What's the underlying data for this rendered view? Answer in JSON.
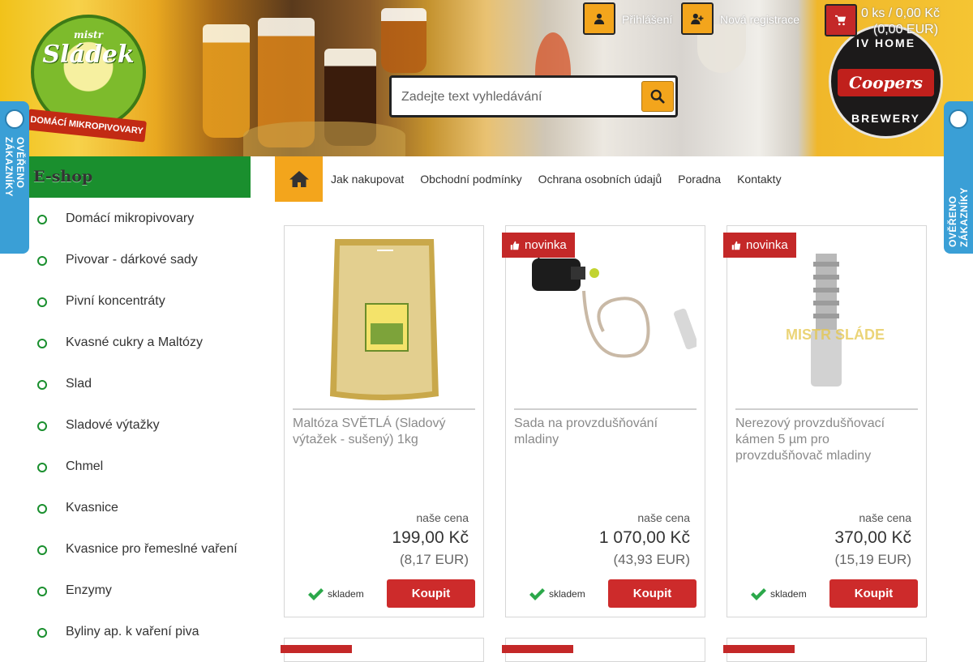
{
  "header": {
    "logo_left": {
      "brand_top": "mistr",
      "brand_main": "Sládek",
      "ribbon": "DOMÁCÍ MIKROPIVOVARY"
    },
    "logo_right": {
      "top": "IV HOME",
      "middle": "Coopers",
      "bottom": "BREWERY"
    },
    "login_label": "Přihlášení",
    "register_label": "Nová registrace",
    "cart": {
      "summary": "0 ks / 0,00 Kč",
      "summary_eur": "(0,00 EUR)"
    },
    "search": {
      "placeholder": "Zadejte text vyhledávání"
    }
  },
  "verified_badge": {
    "text": "OVĚŘENO ZÁKAZNÍKY"
  },
  "sidebar": {
    "title": "E-shop",
    "items": [
      {
        "label": "Domácí mikropivovary"
      },
      {
        "label": "Pivovar - dárkové sady"
      },
      {
        "label": "Pivní koncentráty"
      },
      {
        "label": "Kvasné cukry a Maltózy"
      },
      {
        "label": "Slad"
      },
      {
        "label": "Sladové výtažky"
      },
      {
        "label": "Chmel"
      },
      {
        "label": "Kvasnice"
      },
      {
        "label": "Kvasnice pro řemeslné vaření"
      },
      {
        "label": "Enzymy"
      },
      {
        "label": "Byliny ap. k vaření piva"
      }
    ]
  },
  "nav": {
    "links": [
      {
        "label": "Jak nakupovat"
      },
      {
        "label": "Obchodní podmínky"
      },
      {
        "label": "Ochrana osobních údajů"
      },
      {
        "label": "Poradna"
      },
      {
        "label": "Kontakty"
      }
    ]
  },
  "products": [
    {
      "name": "Maltóza SVĚTLÁ (Sladový výtažek - sušený) 1kg",
      "badge": "",
      "price_label": "naše cena",
      "price": "199,00 Kč",
      "price_eur": "(8,17 EUR)",
      "stock": "skladem",
      "buy_label": "Koupit",
      "image_text": ""
    },
    {
      "name": "Sada na provzdušňování mladiny",
      "badge": "novinka",
      "price_label": "naše cena",
      "price": "1 070,00 Kč",
      "price_eur": "(43,93 EUR)",
      "stock": "skladem",
      "buy_label": "Koupit",
      "image_text": ""
    },
    {
      "name": "Nerezový provzdušňovací kámen 5 µm pro provzdušňovač mladiny",
      "badge": "novinka",
      "price_label": "naše cena",
      "price": "370,00 Kč",
      "price_eur": "(15,19 EUR)",
      "stock": "skladem",
      "buy_label": "Koupit",
      "image_text": "MISTR SLÁDE"
    }
  ],
  "colors": {
    "accent": "#f3a51c",
    "green": "#1a8f2e",
    "red": "#cd2b2b",
    "badge_blue": "#3a9fd6"
  }
}
